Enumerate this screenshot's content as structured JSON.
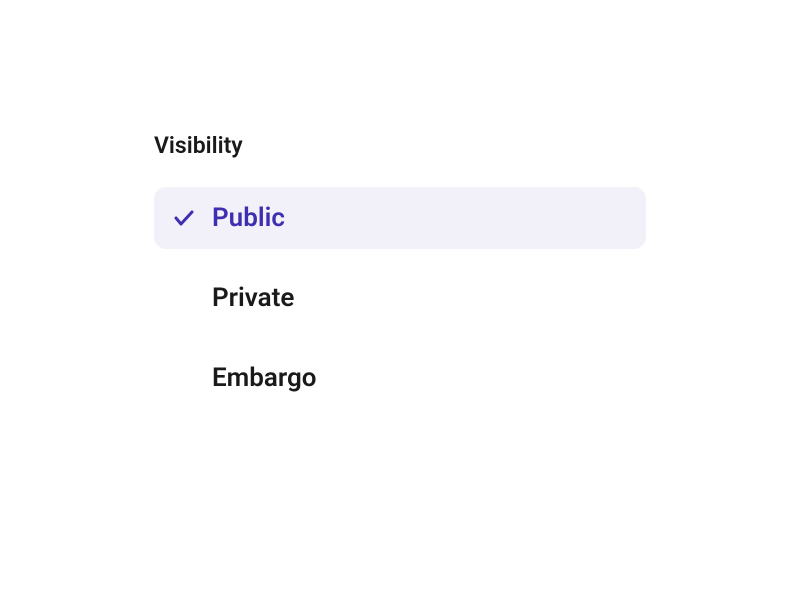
{
  "visibility": {
    "title": "Visibility",
    "options": [
      {
        "label": "Public",
        "selected": true
      },
      {
        "label": "Private",
        "selected": false
      },
      {
        "label": "Embargo",
        "selected": false
      }
    ]
  }
}
